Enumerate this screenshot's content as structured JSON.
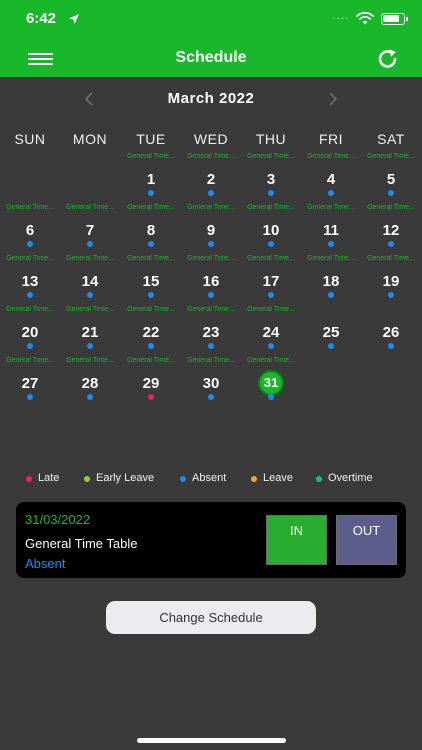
{
  "status_bar": {
    "time": "6:42",
    "signal_dots": "····"
  },
  "app_bar": {
    "title": "Schedule"
  },
  "calendar": {
    "month_label": "March  2022",
    "weekdays": [
      "SUN",
      "MON",
      "TUE",
      "WED",
      "THU",
      "FRI",
      "SAT"
    ],
    "shift_label": "General Time...",
    "weeks": [
      [
        null,
        null,
        {
          "day": "1",
          "shift": true,
          "mark": "absent"
        },
        {
          "day": "2",
          "shift": true,
          "mark": "absent"
        },
        {
          "day": "3",
          "shift": true,
          "mark": "absent"
        },
        {
          "day": "4",
          "shift": true,
          "mark": "absent"
        },
        {
          "day": "5",
          "shift": true,
          "mark": "absent"
        }
      ],
      [
        {
          "day": "6",
          "shift": true,
          "mark": "absent"
        },
        {
          "day": "7",
          "shift": true,
          "mark": "absent"
        },
        {
          "day": "8",
          "shift": true,
          "mark": "absent"
        },
        {
          "day": "9",
          "shift": true,
          "mark": "absent"
        },
        {
          "day": "10",
          "shift": true,
          "mark": "absent"
        },
        {
          "day": "11",
          "shift": true,
          "mark": "absent"
        },
        {
          "day": "12",
          "shift": true,
          "mark": "absent"
        }
      ],
      [
        {
          "day": "13",
          "shift": true,
          "mark": "absent"
        },
        {
          "day": "14",
          "shift": true,
          "mark": "absent"
        },
        {
          "day": "15",
          "shift": true,
          "mark": "absent"
        },
        {
          "day": "16",
          "shift": true,
          "mark": "absent"
        },
        {
          "day": "17",
          "shift": true,
          "mark": "absent"
        },
        {
          "day": "18",
          "shift": true,
          "mark": "absent"
        },
        {
          "day": "19",
          "shift": true,
          "mark": "absent"
        }
      ],
      [
        {
          "day": "20",
          "shift": true,
          "mark": "absent"
        },
        {
          "day": "21",
          "shift": true,
          "mark": "absent"
        },
        {
          "day": "22",
          "shift": true,
          "mark": "absent"
        },
        {
          "day": "23",
          "shift": true,
          "mark": "absent"
        },
        {
          "day": "24",
          "shift": true,
          "mark": "absent"
        },
        {
          "day": "25",
          "shift": false,
          "mark": "absent"
        },
        {
          "day": "26",
          "shift": false,
          "mark": "absent"
        }
      ],
      [
        {
          "day": "27",
          "shift": true,
          "mark": "absent"
        },
        {
          "day": "28",
          "shift": true,
          "mark": "absent"
        },
        {
          "day": "29",
          "shift": true,
          "mark": "late"
        },
        {
          "day": "30",
          "shift": true,
          "mark": "absent"
        },
        {
          "day": "31",
          "shift": true,
          "mark": "absent",
          "today": true
        },
        null,
        null
      ]
    ]
  },
  "legend": [
    {
      "label": "Late",
      "color": "#e8235f"
    },
    {
      "label": "Early Leave",
      "color": "#8fd12a"
    },
    {
      "label": "Absent",
      "color": "#1a8cf0"
    },
    {
      "label": "Leave",
      "color": "#f5a623"
    },
    {
      "label": "Overtime",
      "color": "#1abc8a"
    }
  ],
  "mark_colors": {
    "late": "#e8235f",
    "early_leave": "#8fd12a",
    "absent": "#1a8cf0",
    "leave": "#f5a623",
    "overtime": "#1abc8a"
  },
  "attendance_card": {
    "date": "31/03/2022",
    "shift": "General Time Table",
    "status": "Absent",
    "in_label": "IN",
    "out_label": "OUT"
  },
  "change_schedule_label": "Change Schedule",
  "colors": {
    "brand": "#18b82a",
    "background": "#3a3a3a"
  }
}
